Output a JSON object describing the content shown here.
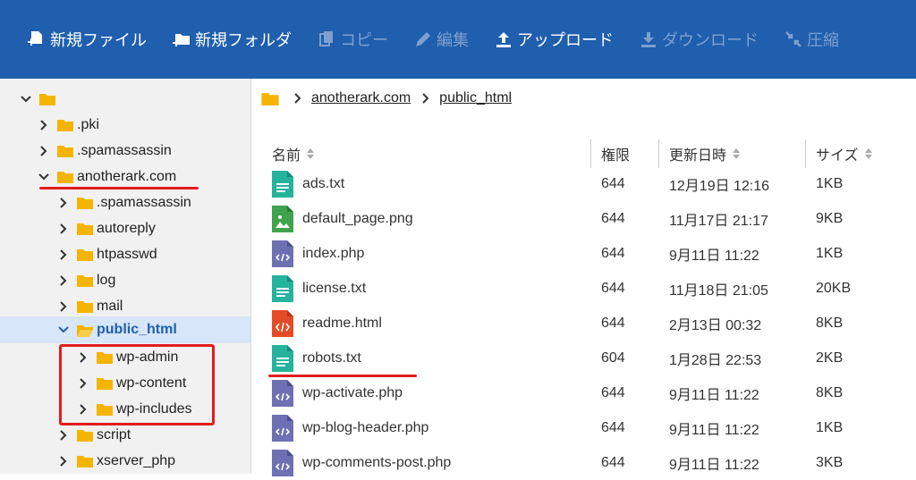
{
  "toolbar": {
    "new_file": "新規ファイル",
    "new_folder": "新規フォルダ",
    "copy": "コピー",
    "edit": "編集",
    "upload": "アップロード",
    "download": "ダウンロード",
    "compress": "圧縮"
  },
  "sidebar": {
    "items": [
      {
        "label": ""
      },
      {
        "label": ".pki"
      },
      {
        "label": ".spamassassin"
      },
      {
        "label": "anotherark.com"
      },
      {
        "label": ".spamassassin"
      },
      {
        "label": "autoreply"
      },
      {
        "label": "htpasswd"
      },
      {
        "label": "log"
      },
      {
        "label": "mail"
      },
      {
        "label": "public_html"
      },
      {
        "label": "wp-admin"
      },
      {
        "label": "wp-content"
      },
      {
        "label": "wp-includes"
      },
      {
        "label": "script"
      },
      {
        "label": "xserver_php"
      }
    ]
  },
  "breadcrumb": {
    "domain": "anotherark.com",
    "folder": "public_html"
  },
  "table": {
    "headers": {
      "name": "名前",
      "perm": "権限",
      "date": "更新日時",
      "size": "サイズ"
    },
    "rows": [
      {
        "name": "ads.txt",
        "perm": "644",
        "date": "12月19日 12:16",
        "size": "1KB",
        "type": "txt"
      },
      {
        "name": "default_page.png",
        "perm": "644",
        "date": "11月17日 21:17",
        "size": "9KB",
        "type": "png"
      },
      {
        "name": "index.php",
        "perm": "644",
        "date": "9月11日 11:22",
        "size": "1KB",
        "type": "php"
      },
      {
        "name": "license.txt",
        "perm": "644",
        "date": "11月18日 21:05",
        "size": "20KB",
        "type": "txt"
      },
      {
        "name": "readme.html",
        "perm": "644",
        "date": "2月13日 00:32",
        "size": "8KB",
        "type": "html"
      },
      {
        "name": "robots.txt",
        "perm": "604",
        "date": "1月28日 22:53",
        "size": "2KB",
        "type": "txt"
      },
      {
        "name": "wp-activate.php",
        "perm": "644",
        "date": "9月11日 11:22",
        "size": "8KB",
        "type": "php"
      },
      {
        "name": "wp-blog-header.php",
        "perm": "644",
        "date": "9月11日 11:22",
        "size": "1KB",
        "type": "php"
      },
      {
        "name": "wp-comments-post.php",
        "perm": "644",
        "date": "9月11日 11:22",
        "size": "3KB",
        "type": "php"
      }
    ]
  },
  "colors": {
    "toolbar_bg": "#1f5fae",
    "folder": "#f5b400",
    "txt_icon": "#25b39e",
    "png_icon": "#3fa34d",
    "php_icon": "#6f6fb3",
    "html_icon": "#e34c26",
    "annotation_red": "#e21d1d"
  }
}
